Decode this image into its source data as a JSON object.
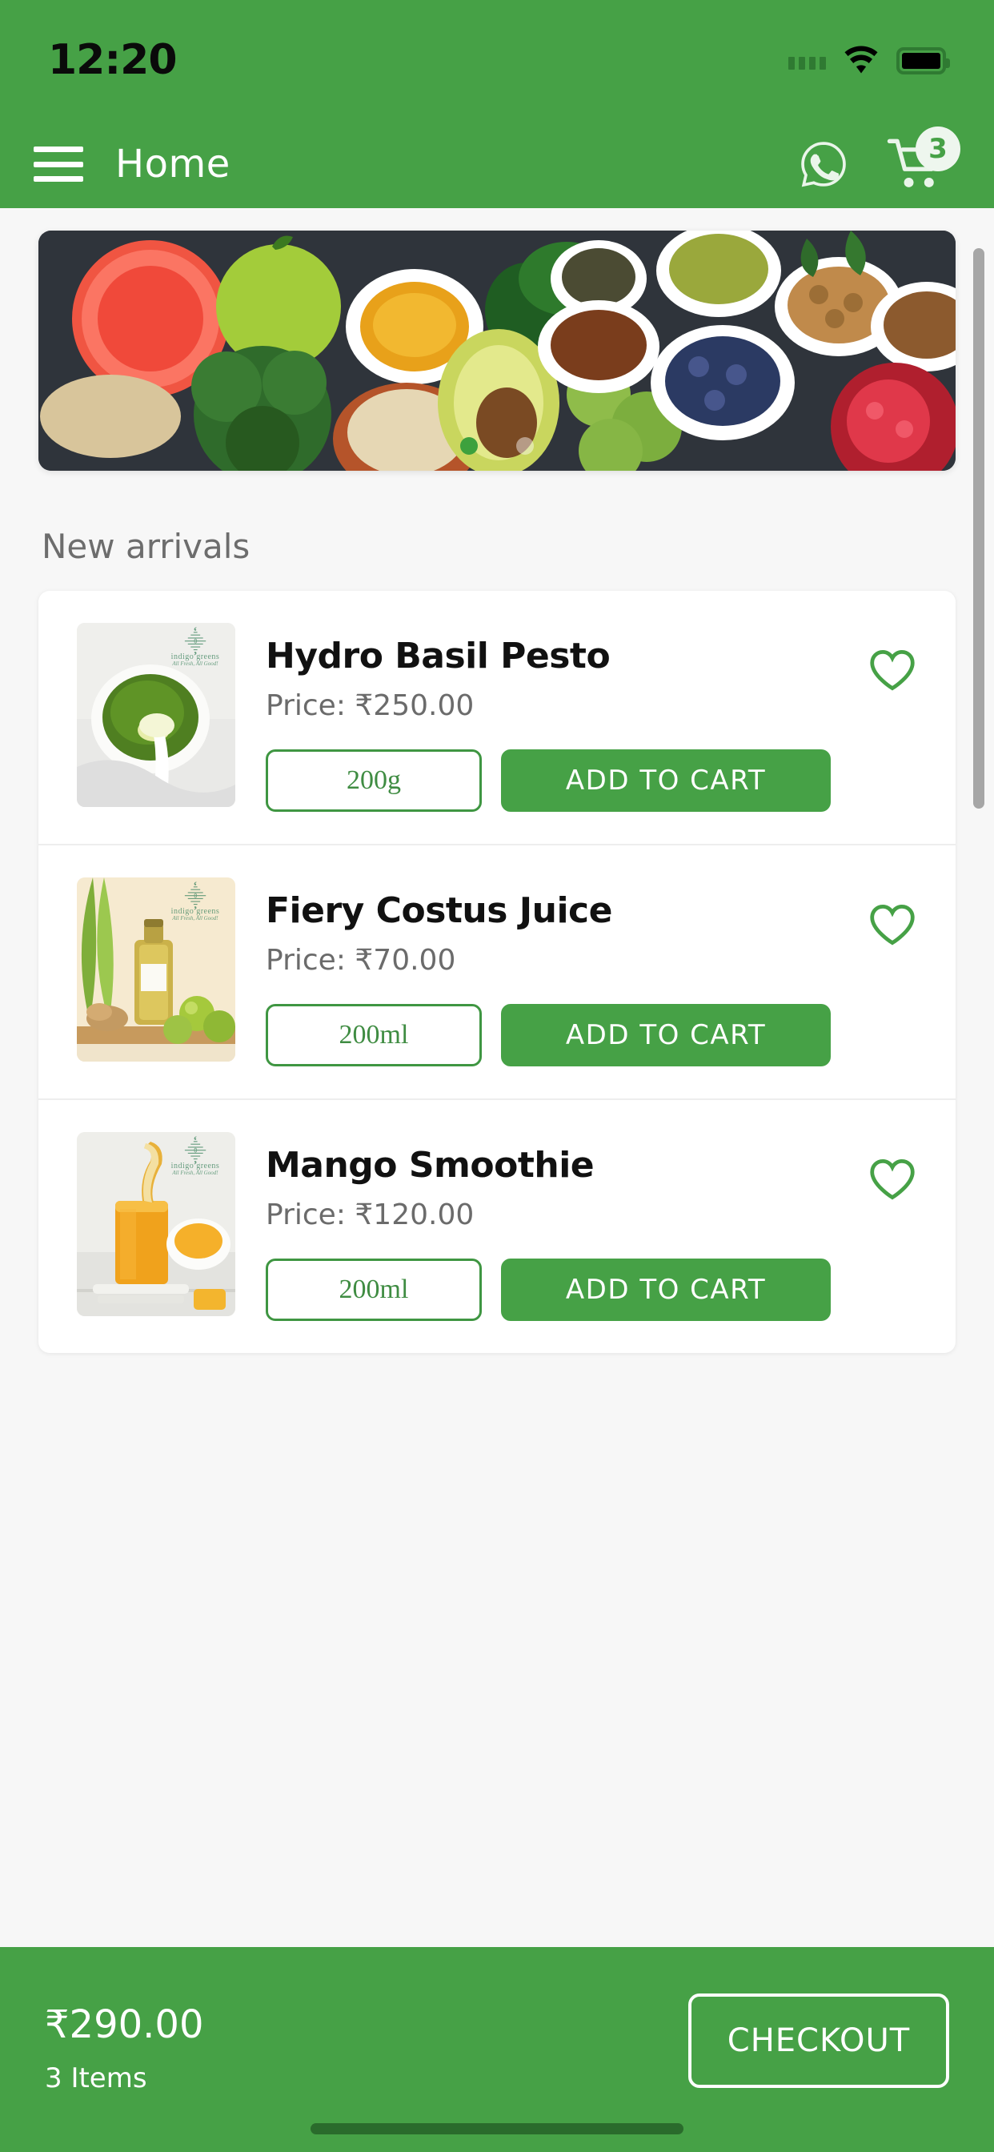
{
  "theme": {
    "brand_green": "#46a146",
    "accent_green": "#3f9642",
    "page_bg": "#f7f7f7"
  },
  "statusbar": {
    "time": "12:20",
    "wifi_icon": "wifi-icon",
    "battery_icon": "battery-icon",
    "signal_icon": "signal-icon"
  },
  "appbar": {
    "menu_icon": "hamburger-menu-icon",
    "title": "Home",
    "whatsapp_icon": "whatsapp-icon",
    "cart_icon": "shopping-cart-icon",
    "cart_badge": "3"
  },
  "banner": {
    "alt": "assorted-healthy-foods-banner",
    "active_dot_index": 0,
    "dot_count": 2
  },
  "section": {
    "title": "New arrivals"
  },
  "products": [
    {
      "name": "Hydro Basil Pesto",
      "price_label": "Price: ₹250.00",
      "variant": "200g",
      "add_to_cart_label": "ADD TO CART",
      "favorite_icon": "heart-outline-icon",
      "image_alt": "bowl-of-green-basil-pesto",
      "watermark": {
        "mark": "⸎",
        "name": "indigo greens",
        "tagline": "All Fresh, All Good!"
      }
    },
    {
      "name": "Fiery Costus Juice",
      "price_label": "Price: ₹70.00",
      "variant": "200ml",
      "add_to_cart_label": "ADD TO CART",
      "favorite_icon": "heart-outline-icon",
      "image_alt": "bottle-of-costus-juice-with-limes",
      "watermark": {
        "mark": "⸎",
        "name": "indigo greens",
        "tagline": "All Fresh, All Good!"
      }
    },
    {
      "name": "Mango Smoothie",
      "price_label": "Price: ₹120.00",
      "variant": "200ml",
      "add_to_cart_label": "ADD TO CART",
      "favorite_icon": "heart-outline-icon",
      "image_alt": "glass-of-mango-smoothie-with-straw",
      "watermark": {
        "mark": "⸎",
        "name": "indigo greens",
        "tagline": "All Fresh, All Good!"
      }
    }
  ],
  "bottombar": {
    "total": "₹290.00",
    "items": "3 Items",
    "checkout_label": "CHECKOUT"
  }
}
